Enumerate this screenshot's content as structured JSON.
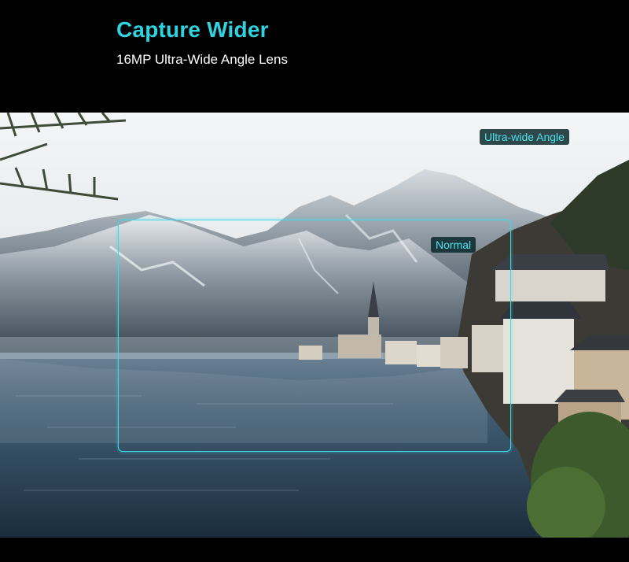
{
  "header": {
    "title": "Capture Wider",
    "subtitle": "16MP Ultra-Wide Angle Lens"
  },
  "labels": {
    "normal": "Normal",
    "ultra_wide": "Ultra-wide Angle"
  },
  "colors": {
    "accent": "#2fd3e0",
    "frame": "#3fd8e6",
    "background": "#000000"
  }
}
